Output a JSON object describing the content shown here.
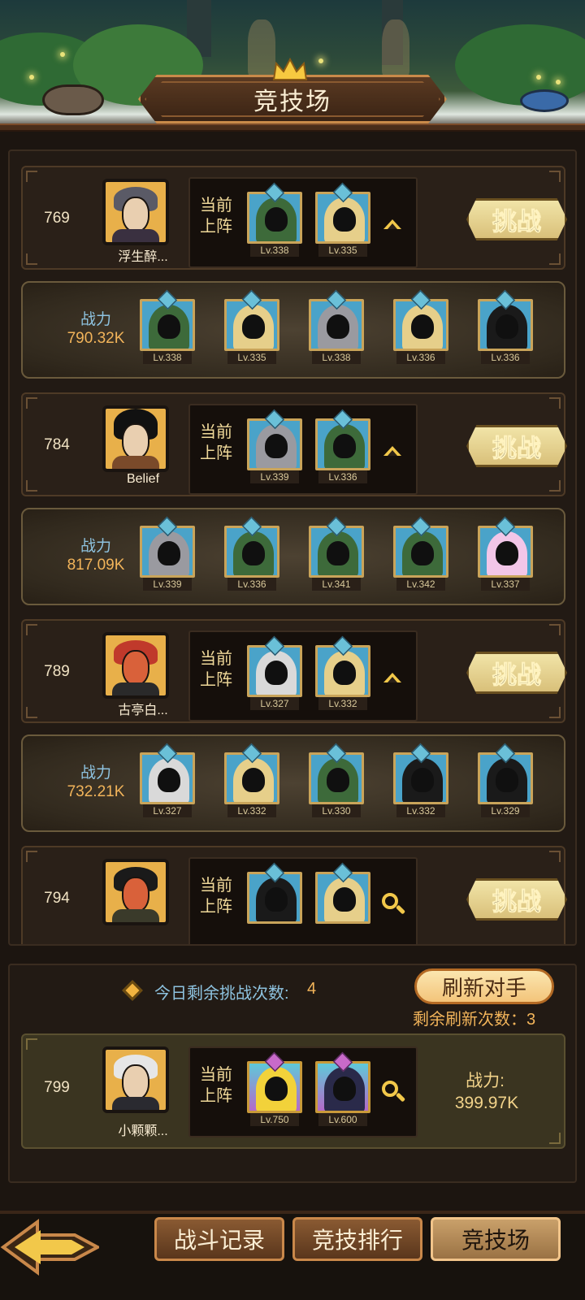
{
  "page": {
    "title": "竞技场"
  },
  "opponents": [
    {
      "rank": "769",
      "name": "浮生醉...",
      "lineup_label": "当前上阵",
      "lineup": [
        {
          "lv": "Lv.338"
        },
        {
          "lv": "Lv.335"
        }
      ],
      "toggle": "up",
      "challenge": "挑战",
      "power_label": "战力",
      "power": "790.32K",
      "team": [
        {
          "lv": "Lv.338"
        },
        {
          "lv": "Lv.335"
        },
        {
          "lv": "Lv.338"
        },
        {
          "lv": "Lv.336"
        },
        {
          "lv": "Lv.336"
        }
      ]
    },
    {
      "rank": "784",
      "name": "Belief",
      "lineup_label": "当前上阵",
      "lineup": [
        {
          "lv": "Lv.339"
        },
        {
          "lv": "Lv.336"
        }
      ],
      "toggle": "up",
      "challenge": "挑战",
      "power_label": "战力",
      "power": "817.09K",
      "team": [
        {
          "lv": "Lv.339"
        },
        {
          "lv": "Lv.336"
        },
        {
          "lv": "Lv.341"
        },
        {
          "lv": "Lv.342"
        },
        {
          "lv": "Lv.337"
        }
      ]
    },
    {
      "rank": "789",
      "name": "古亭白...",
      "lineup_label": "当前上阵",
      "lineup": [
        {
          "lv": "Lv.327"
        },
        {
          "lv": "Lv.332"
        }
      ],
      "toggle": "up",
      "challenge": "挑战",
      "power_label": "战力",
      "power": "732.21K",
      "team": [
        {
          "lv": "Lv.327"
        },
        {
          "lv": "Lv.332"
        },
        {
          "lv": "Lv.330"
        },
        {
          "lv": "Lv.332"
        },
        {
          "lv": "Lv.329"
        }
      ]
    },
    {
      "rank": "794",
      "name": "",
      "lineup_label": "当前上阵",
      "lineup": [
        {
          "lv": ""
        },
        {
          "lv": ""
        }
      ],
      "toggle": "search",
      "challenge": "挑战"
    }
  ],
  "status": {
    "remaining_label": "今日剩余挑战次数:",
    "remaining_value": "4",
    "refresh_button": "刷新对手",
    "refresh_count": "剩余刷新次数：3"
  },
  "self": {
    "rank": "799",
    "name": "小颗颗...",
    "lineup_label": "当前上阵",
    "lineup": [
      {
        "lv": "Lv.750"
      },
      {
        "lv": "Lv.600"
      }
    ],
    "power_label": "战力:",
    "power": "399.97K"
  },
  "nav": {
    "tabs": [
      {
        "label": "战斗记录"
      },
      {
        "label": "竞技排行"
      },
      {
        "label": "竞技场"
      }
    ]
  },
  "colors": {
    "accent": "#f2b45a",
    "power_label": "#8ec3e0",
    "card": "#4aa3c9"
  }
}
